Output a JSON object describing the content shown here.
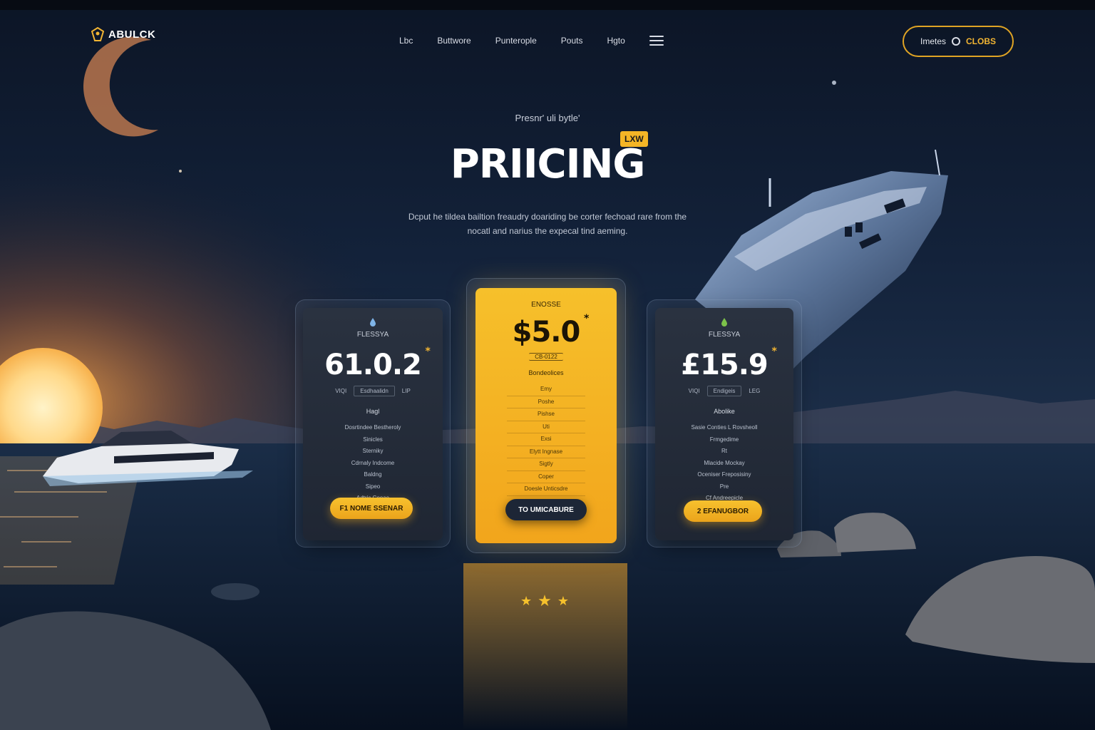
{
  "brand": {
    "name": "ABULCK",
    "accent": "#f2b533"
  },
  "nav": {
    "items": [
      "Lbc",
      "Buttwore",
      "Punterople",
      "Pouts",
      "Hgto"
    ],
    "menu_icon": "hamburger-icon"
  },
  "header_cta": {
    "label": "Imetes",
    "accent_label": "CLOBS"
  },
  "hero": {
    "eyebrow": "Presnr' uli bytle'",
    "title": "PRIICING",
    "badge": "LXW",
    "subtitle": "Dcput he tildea bailtion freaudry doariding be corter fechoad rare from the nocatl and narius the expecal tind aeming."
  },
  "plans": [
    {
      "name": "FLESSYA",
      "price": "61.0.2",
      "price_mark": "*",
      "sub_left": "VIQI",
      "sub_box": "Esdhaalidn",
      "sub_right": "LIP",
      "feature_head": "Hagl",
      "features": [
        "Dosrtindee Bestheroly",
        "Sinicles",
        "Sterniky",
        "Cdrnaly Indcome",
        "Baldng",
        "Sipeo",
        "Adtric Cooae"
      ],
      "button": "F1 NOME SSENAR",
      "icon": "water-drop-icon",
      "highlight": false
    },
    {
      "name": "ENOSSE",
      "price": "$5.0",
      "price_mark": "*",
      "sub_box": "CB-0122",
      "feature_head": "Bondeolices",
      "features": [
        "Emy",
        "Poshe",
        "Pishse",
        "Uti",
        "Exsi",
        "Elytt Ingnase",
        "Sigtly",
        "Coper",
        "Doesle Unticsdre"
      ],
      "button": "TO UMICABURE",
      "icon": "pin-icon",
      "highlight": true
    },
    {
      "name": "FLESSYA",
      "price": "£15.9",
      "price_mark": "*",
      "sub_left": "VIQI",
      "sub_box": "Endigeis",
      "sub_right": "LEG",
      "feature_head": "Abolike",
      "features": [
        "Sasie Conties L Rovsheoll",
        "Frmgedime",
        "Rt",
        "Mlacide Mockay",
        "Oceniser Freposisiny",
        "Pre",
        "Cf Andreepicle"
      ],
      "button": "2 EFANUGBOR",
      "icon": "leaf-drop-icon",
      "highlight": false
    }
  ],
  "rating": {
    "stars": 3,
    "max": 3
  }
}
